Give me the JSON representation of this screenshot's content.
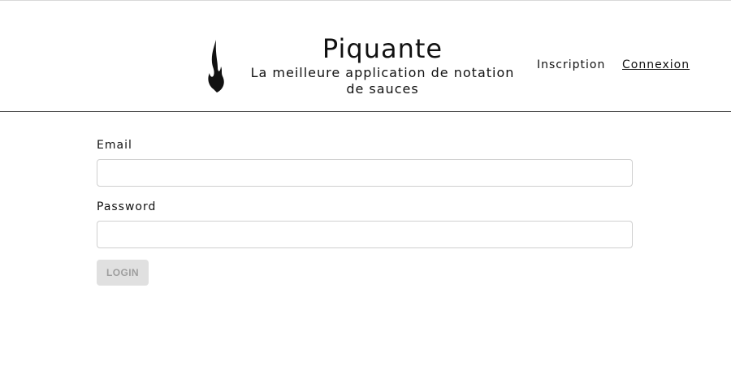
{
  "header": {
    "logo_icon": "flame-icon",
    "title": "Piquante",
    "tagline": "La meilleure application de notation de sauces",
    "nav": {
      "signup_label": "Inscription",
      "login_label": "Connexion"
    }
  },
  "login_form": {
    "email_label": "Email",
    "email_value": "",
    "password_label": "Password",
    "password_value": "",
    "submit_label": "LOGIN",
    "submit_disabled": true
  }
}
